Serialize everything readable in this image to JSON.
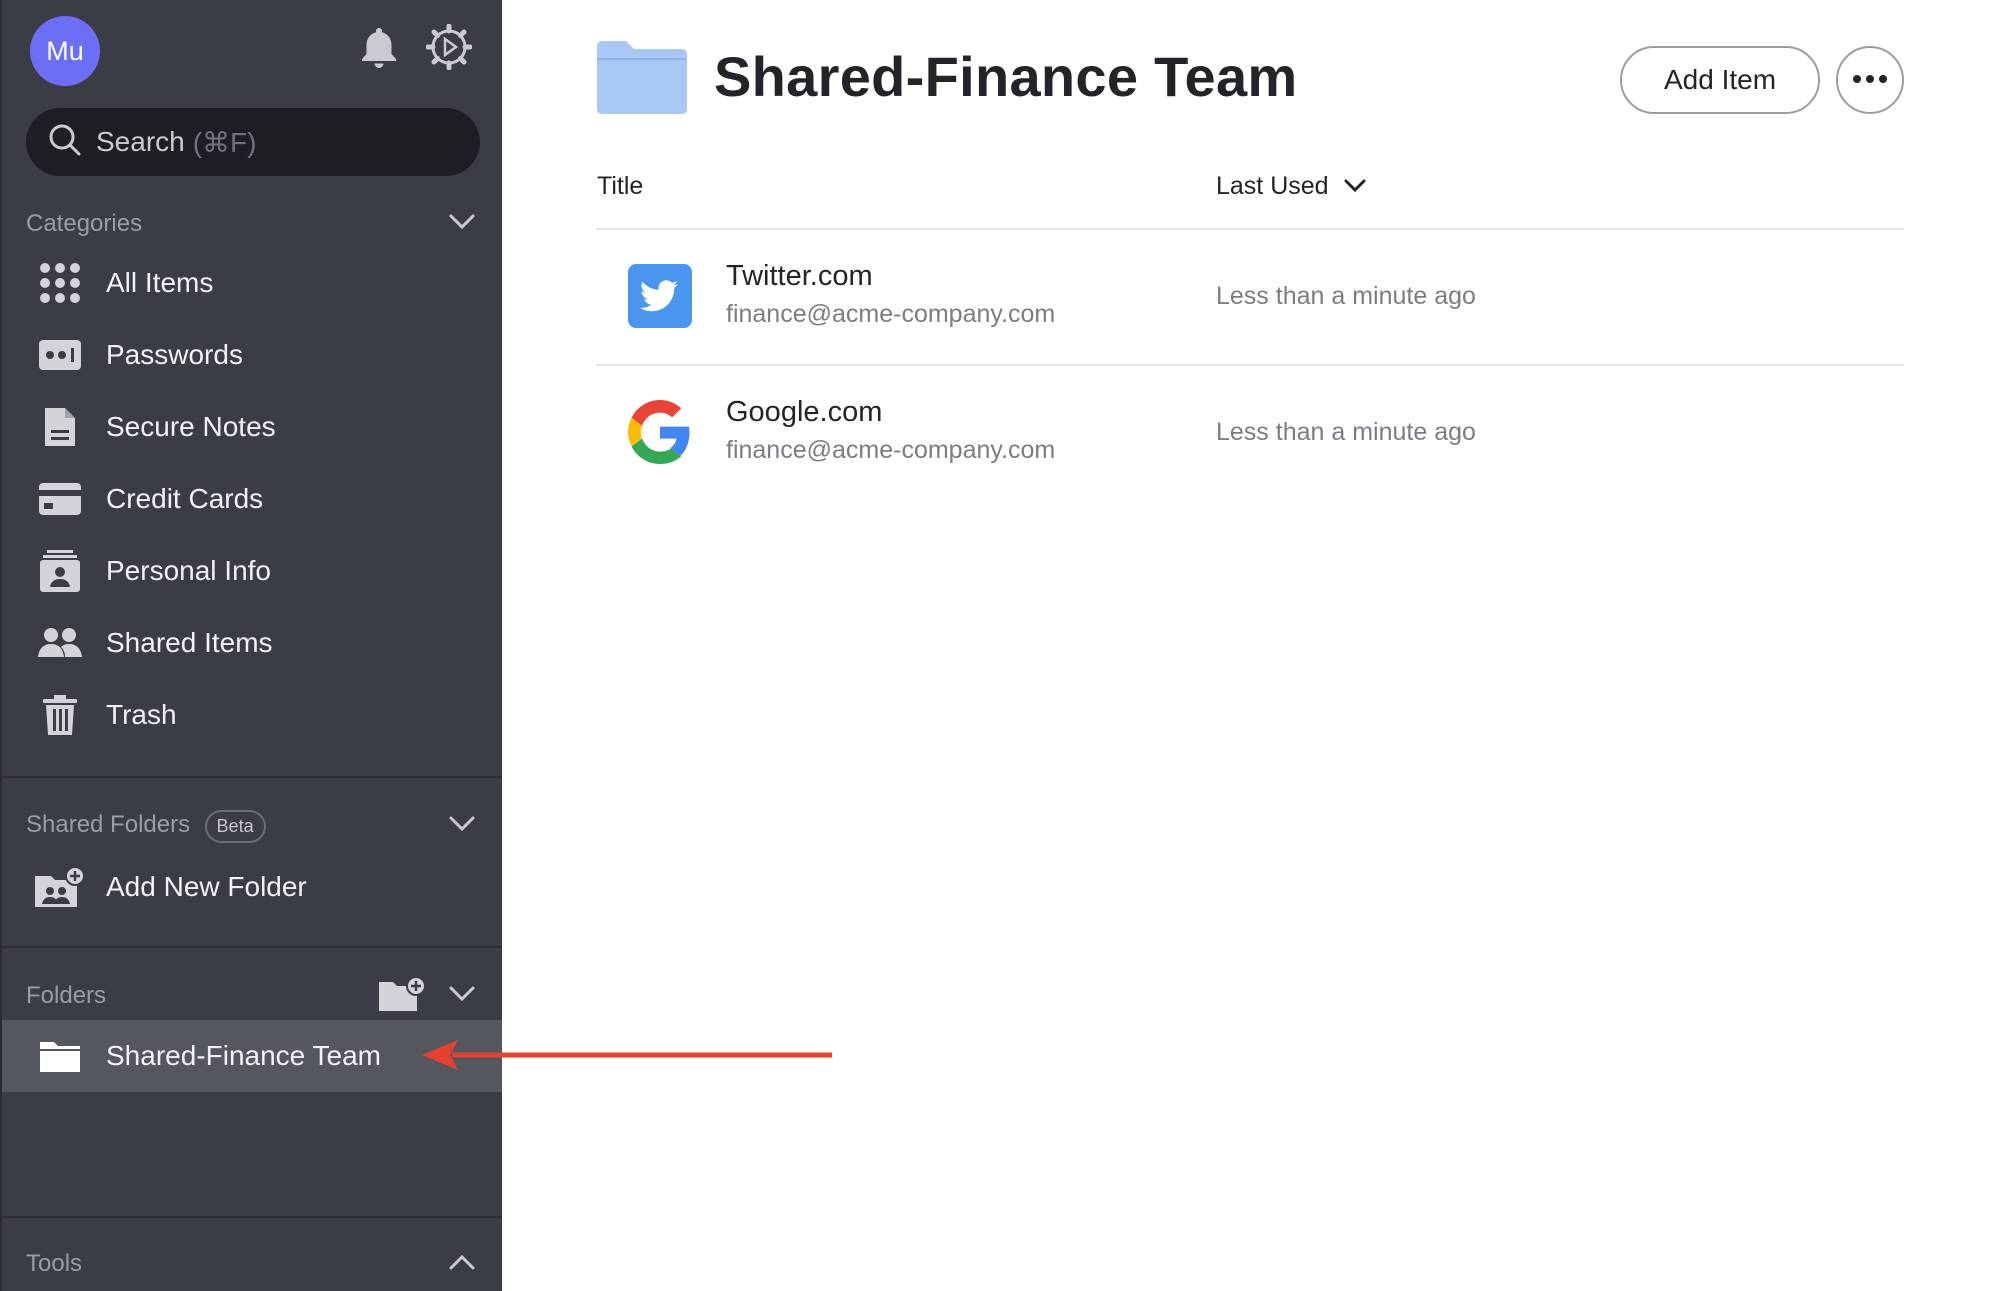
{
  "user": {
    "initials": "Mu"
  },
  "sidebar": {
    "search": {
      "placeholder": "Search",
      "shortcut": "(⌘F)"
    },
    "categories": {
      "heading": "Categories",
      "items": [
        {
          "label": "All Items",
          "icon": "grid-icon"
        },
        {
          "label": "Passwords",
          "icon": "password-icon"
        },
        {
          "label": "Secure Notes",
          "icon": "note-icon"
        },
        {
          "label": "Credit Cards",
          "icon": "credit-card-icon"
        },
        {
          "label": "Personal Info",
          "icon": "personal-info-icon"
        },
        {
          "label": "Shared Items",
          "icon": "people-icon"
        },
        {
          "label": "Trash",
          "icon": "trash-icon"
        }
      ]
    },
    "shared_folders": {
      "heading": "Shared Folders",
      "badge": "Beta",
      "add_label": "Add New Folder"
    },
    "folders": {
      "heading": "Folders",
      "items": [
        {
          "label": "Shared-Finance Team",
          "selected": true
        }
      ]
    },
    "tools": {
      "heading": "Tools"
    }
  },
  "main": {
    "title": "Shared-Finance Team",
    "add_item_label": "Add Item",
    "columns": {
      "title": "Title",
      "last_used": "Last Used"
    },
    "items": [
      {
        "name": "Twitter.com",
        "email": "finance@acme-company.com",
        "last_used": "Less than a minute ago",
        "icon": "twitter-icon"
      },
      {
        "name": "Google.com",
        "email": "finance@acme-company.com",
        "last_used": "Less than a minute ago",
        "icon": "google-icon"
      }
    ]
  },
  "colors": {
    "sidebar_bg": "#3a3d44",
    "avatar": "#6b6ff5",
    "arrow": "#e8402f",
    "folder": "#a9c8f5"
  }
}
